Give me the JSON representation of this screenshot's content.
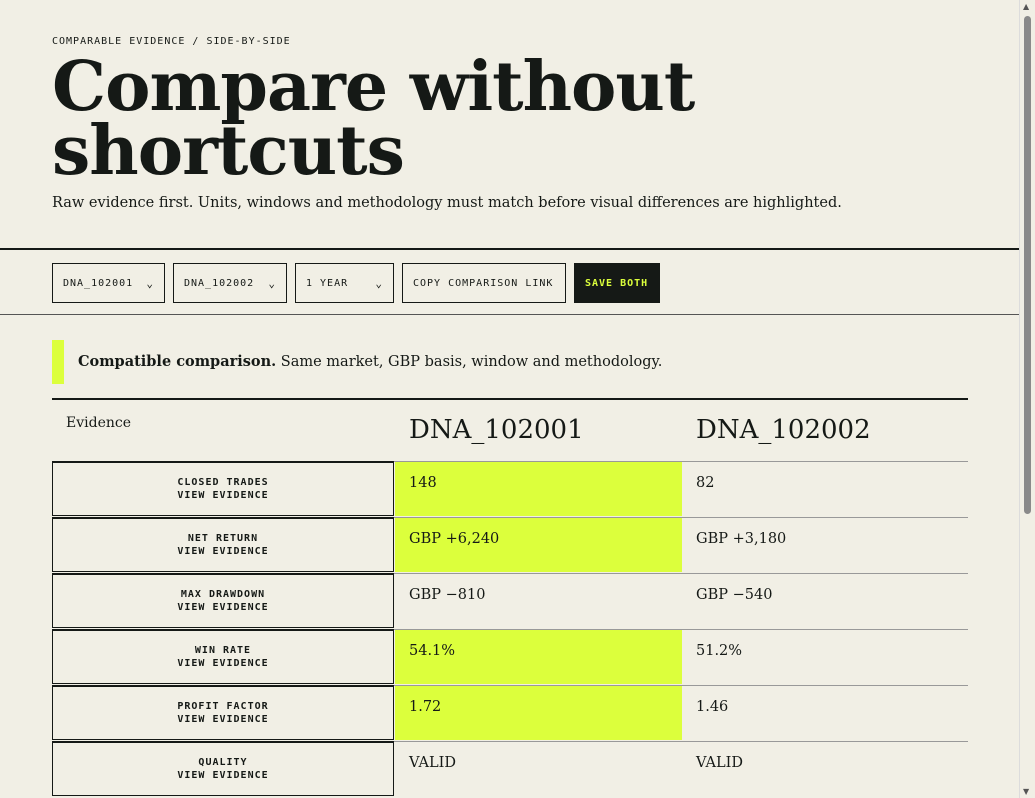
{
  "header": {
    "kicker": "COMPARABLE EVIDENCE / SIDE-BY-SIDE",
    "title": "Compare without shortcuts",
    "lede": "Raw evidence first. Units, windows and methodology must match before visual differences are highlighted."
  },
  "toolbar": {
    "strategy_a": "DNA_102001",
    "strategy_b": "DNA_102002",
    "window": "1 YEAR",
    "copy_link": "COPY COMPARISON LINK",
    "save": "SAVE BOTH"
  },
  "notice": {
    "strong": "Compatible comparison.",
    "text": " Same market, GBP basis, window and methodology."
  },
  "table": {
    "evidence_header": "Evidence",
    "col_a": "DNA_102001",
    "col_b": "DNA_102002",
    "view_label": "VIEW EVIDENCE",
    "rows": [
      {
        "label": "CLOSED TRADES",
        "a": "148",
        "b": "82",
        "highlight": "a"
      },
      {
        "label": "NET RETURN",
        "a": "GBP +6,240",
        "b": "GBP +3,180",
        "highlight": "a"
      },
      {
        "label": "MAX DRAWDOWN",
        "a": "GBP −810",
        "b": "GBP −540",
        "highlight": "none"
      },
      {
        "label": "WIN RATE",
        "a": "54.1%",
        "b": "51.2%",
        "highlight": "a"
      },
      {
        "label": "PROFIT FACTOR",
        "a": "1.72",
        "b": "1.46",
        "highlight": "a"
      },
      {
        "label": "QUALITY",
        "a": "VALID",
        "b": "VALID",
        "highlight": "none"
      }
    ]
  },
  "colors": {
    "background": "#f1efe5",
    "ink": "#151916",
    "accent": "#dcff3c"
  }
}
